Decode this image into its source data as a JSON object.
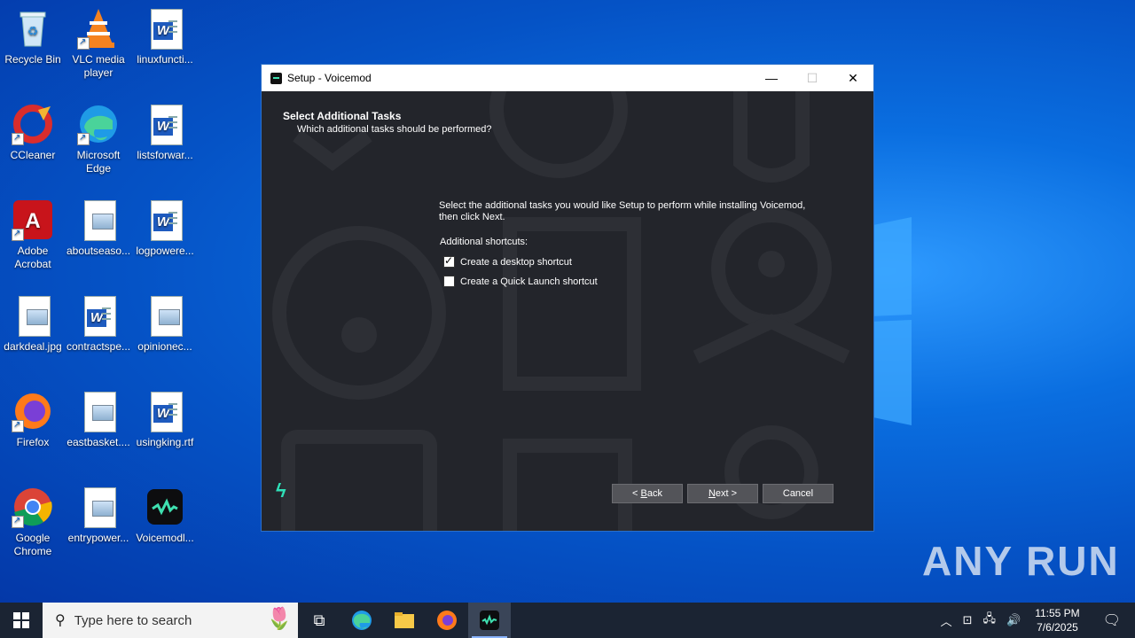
{
  "desktop": {
    "icons": [
      {
        "label": "Recycle Bin"
      },
      {
        "label": "VLC media player"
      },
      {
        "label": "linuxfuncti..."
      },
      {
        "label": "CCleaner"
      },
      {
        "label": "Microsoft Edge"
      },
      {
        "label": "listsforwar..."
      },
      {
        "label": "Adobe Acrobat"
      },
      {
        "label": "aboutseaso..."
      },
      {
        "label": "logpowere..."
      },
      {
        "label": "darkdeal.jpg"
      },
      {
        "label": "contractspe..."
      },
      {
        "label": "opinionec..."
      },
      {
        "label": "Firefox"
      },
      {
        "label": "eastbasket...."
      },
      {
        "label": "usingking.rtf"
      },
      {
        "label": "Google Chrome"
      },
      {
        "label": "entrypower..."
      },
      {
        "label": "Voicemodl..."
      }
    ]
  },
  "setup": {
    "title": "Setup - Voicemod",
    "heading": "Select Additional Tasks",
    "subheading": "Which additional tasks should be performed?",
    "description": "Select the additional tasks you would like Setup to perform while installing Voicemod, then click Next.",
    "shortcuts_label": "Additional shortcuts:",
    "options": [
      {
        "label": "Create a desktop shortcut",
        "checked": true
      },
      {
        "label": "Create a Quick Launch shortcut",
        "checked": false
      }
    ],
    "back_prefix": "< ",
    "back_key": "B",
    "back_rest": "ack",
    "next_key": "N",
    "next_rest": "ext >",
    "cancel": "Cancel"
  },
  "watermark": "ANY RUN",
  "taskbar": {
    "search_placeholder": "Type here to search",
    "time": "11:55 PM",
    "date": "7/6/2025"
  },
  "colors": {
    "accent": "#2fe0b8",
    "dialog_bg": "#23252b",
    "button_bg": "#535459"
  }
}
